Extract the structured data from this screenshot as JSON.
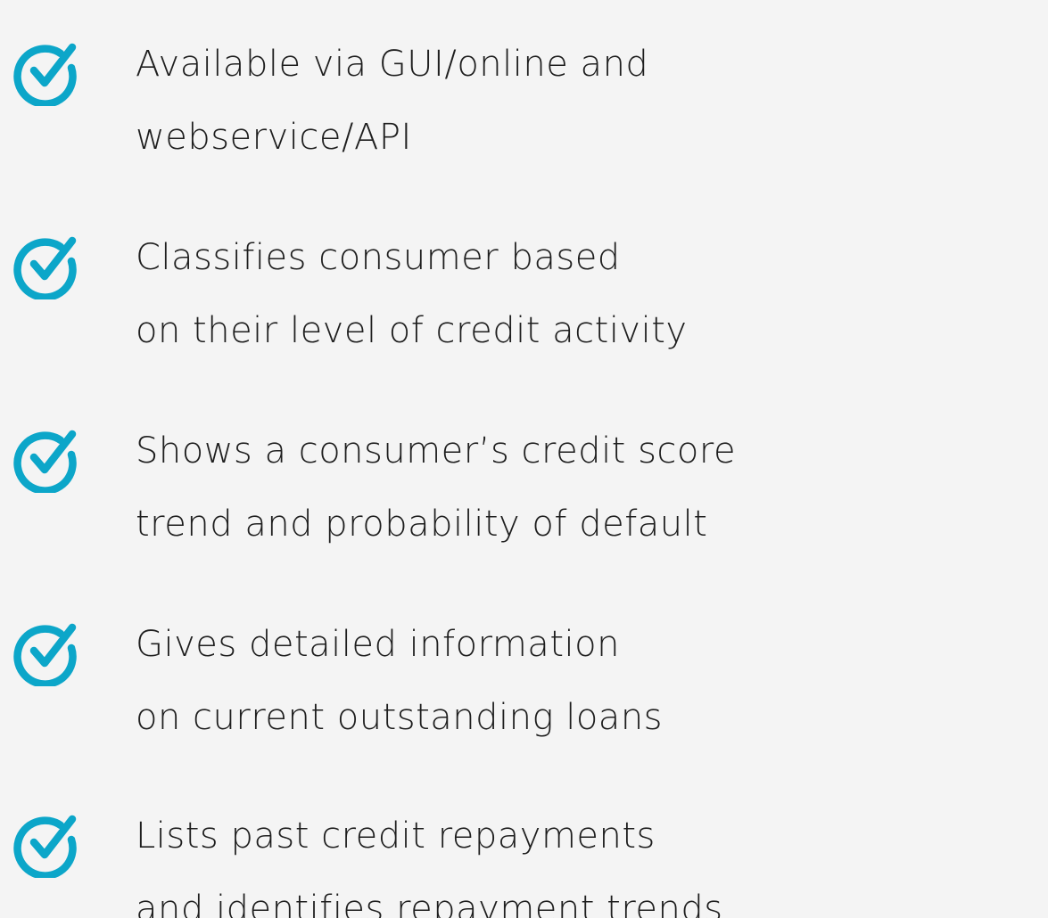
{
  "accent_color": "#0ca6c9",
  "icon": "check-circle-icon",
  "features": [
    {
      "line1": "Available via GUI/online and",
      "line2": "webservice/API"
    },
    {
      "line1": "Classifies consumer based",
      "line2": "on their level of credit activity"
    },
    {
      "line1": "Shows a consumer’s credit score",
      "line2": "trend and probability of default"
    },
    {
      "line1": "Gives detailed information",
      "line2": "on current outstanding loans"
    },
    {
      "line1": "Lists past credit repayments",
      "line2": "and identifies repayment trends"
    }
  ]
}
